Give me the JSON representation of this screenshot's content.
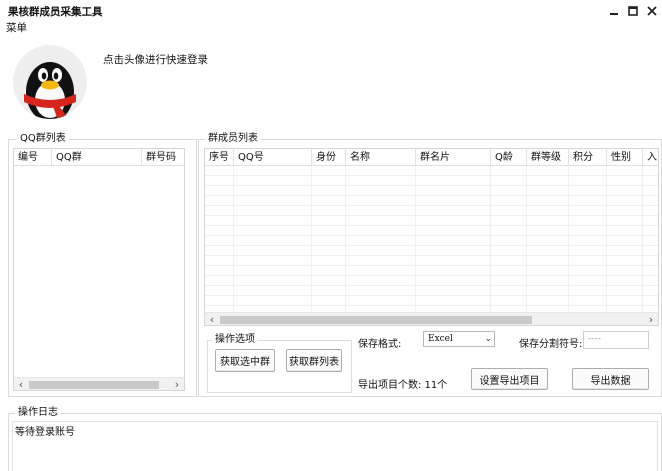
{
  "window": {
    "title": "果核群成员采集工具",
    "menu_label": "菜单"
  },
  "login": {
    "hint": "点击头像进行快速登录"
  },
  "qq_group_list": {
    "legend": "QQ群列表",
    "columns": [
      "编号",
      "QQ群",
      "群号码"
    ]
  },
  "member_list": {
    "legend": "群成员列表",
    "columns": [
      "序号",
      "QQ号",
      "身份",
      "名称",
      "群名片",
      "Q龄",
      "群等级",
      "积分",
      "性别",
      "入"
    ]
  },
  "options": {
    "legend": "操作选项",
    "get_selected_group": "获取选中群",
    "get_group_list": "获取群列表"
  },
  "export": {
    "format_label": "保存格式:",
    "format_value": "Excel",
    "separator_label": "保存分割符号:",
    "separator_value": "----",
    "item_count_label": "导出项目个数: 11个",
    "set_items_button": "设置导出项目",
    "export_button": "导出数据"
  },
  "log": {
    "legend": "操作日志",
    "text": "等待登录账号"
  },
  "colors": {
    "penguin_red": "#d4261d",
    "penguin_yellow": "#f5b60e",
    "border": "#dcdcdc"
  }
}
